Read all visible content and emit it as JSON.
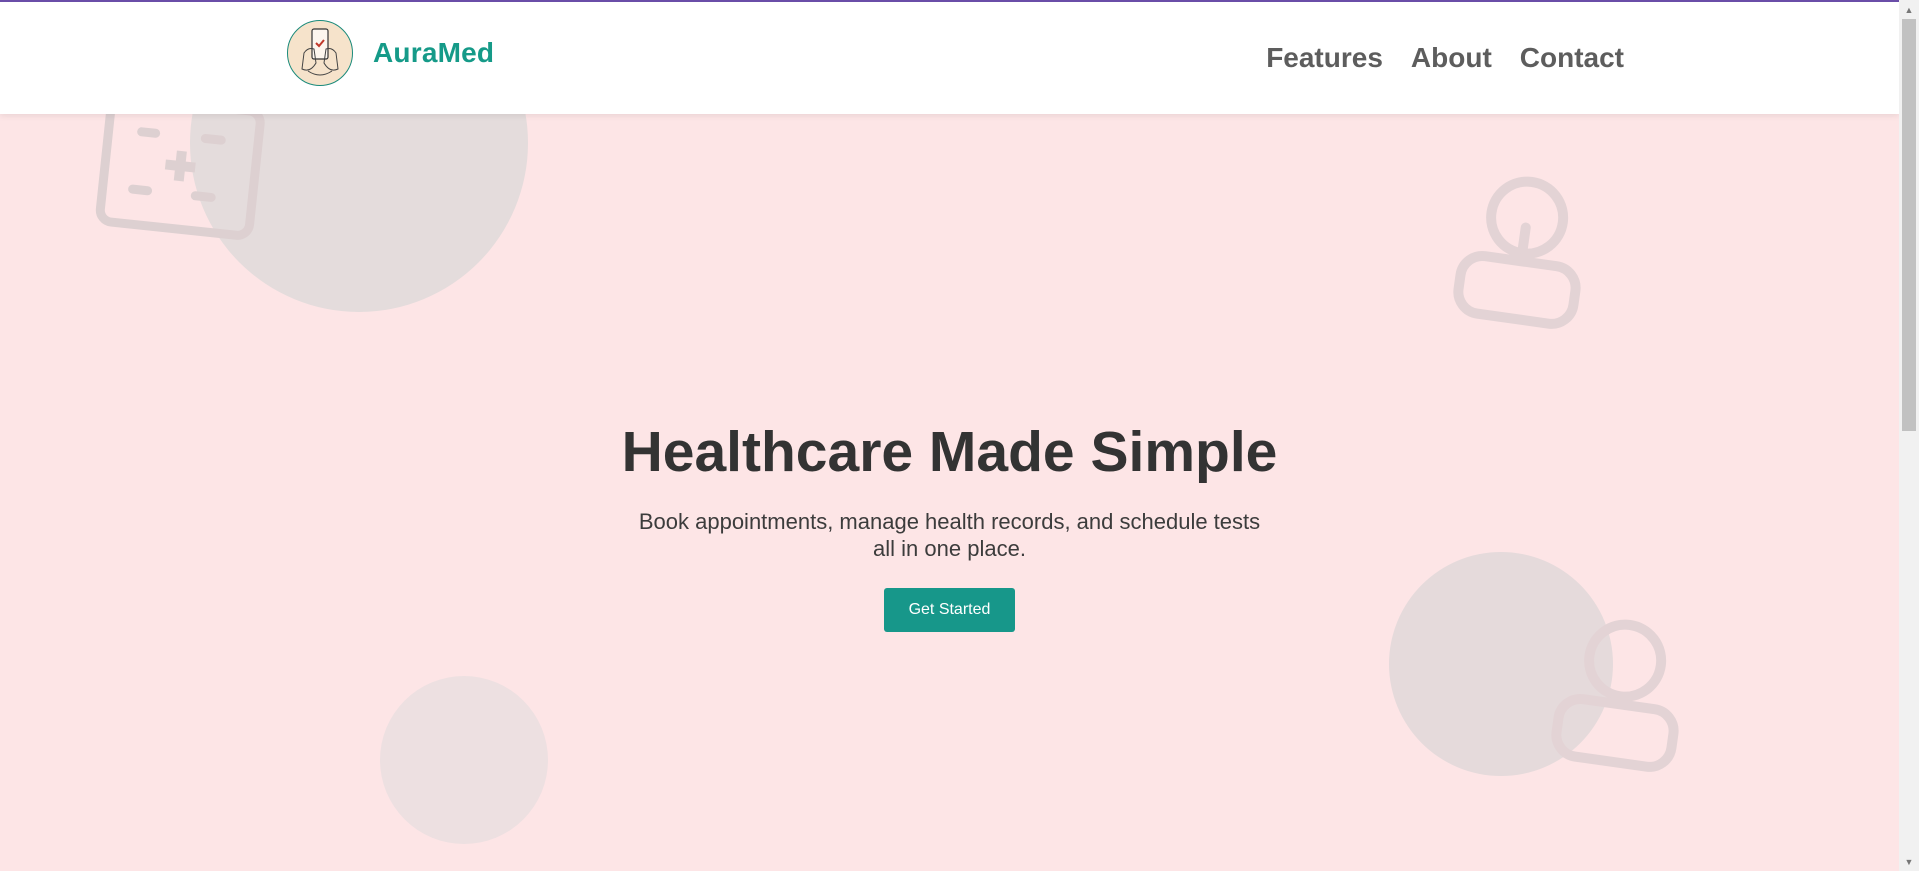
{
  "header": {
    "brand_name": "AuraMed",
    "logo_icon": "hand-holding-phone-icon"
  },
  "nav": {
    "items": [
      "Features",
      "About",
      "Contact"
    ]
  },
  "hero": {
    "title": "Healthcare Made Simple",
    "subtitle": "Book appointments, manage health records, and schedule tests all in one place.",
    "cta_label": "Get Started"
  },
  "colors": {
    "accent": "#159a88",
    "hero_background": "#fde5e6",
    "top_bar": "#6a4ea8"
  },
  "decorations": [
    "medicine-box-icon",
    "user-icon",
    "user-icon"
  ]
}
